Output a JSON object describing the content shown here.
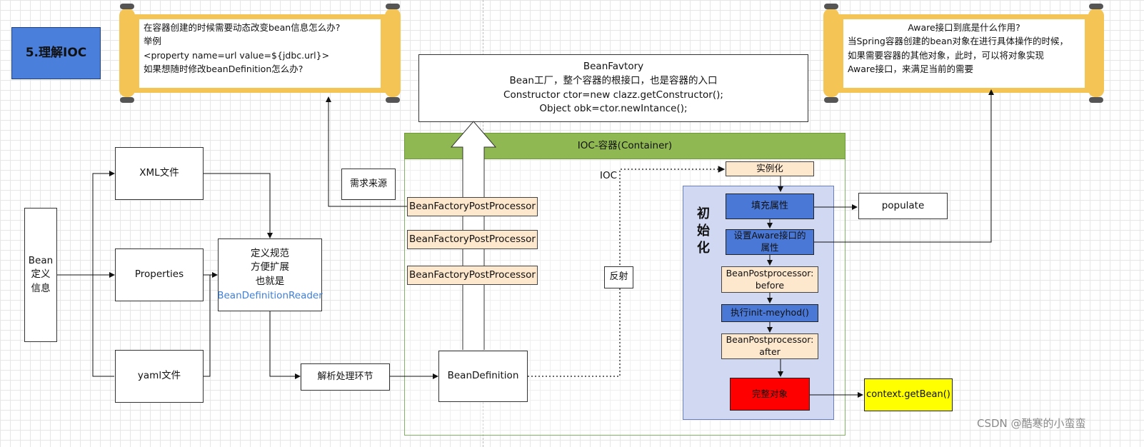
{
  "title": "5.理解IOC",
  "scroll_left": {
    "lines": [
      "在容器创建的时候需要动态改变bean信息怎么办?",
      "举例",
      "<property name=url value=${jdbc.url}>",
      "如果想随时修改beanDefinition怎么办?"
    ]
  },
  "scroll_right": {
    "lines": [
      "Aware接口到底是什么作用?",
      "当Spring容器创建的bean对象在进行具体操作的时候，",
      "如果需要容器的其他对象，此时，可以将对象实现",
      "Aware接口，来满足当前的需要"
    ]
  },
  "bean_factory": {
    "lines": [
      "BeanFavtory",
      "Bean工厂，整个容器的根接口，也是容器的入口",
      "Constructor ctor=new clazz.getConstructor();",
      "Object obk=ctor.newIntance();"
    ]
  },
  "container_title": "IOC-容器(Container)",
  "bean_def_info": [
    "Bean",
    "定义",
    "信息"
  ],
  "xml_file": "XML文件",
  "properties": "Properties",
  "yaml_file": "yaml文件",
  "reader": {
    "lines": [
      "定义规范",
      "方便扩展",
      "也就是"
    ],
    "link": "BeanDefinitionReader",
    "link_color": "#3f7fd8"
  },
  "parse": "解析处理环节",
  "bean_definition": "BeanDefinition",
  "demand_source": "需求来源",
  "post_processors": [
    "BeanFactoryPostProcessor",
    "BeanFactoryPostProcessor",
    "BeanFactoryPostProcessor"
  ],
  "ioc_label": "IOC",
  "reflect": "反射",
  "instantiate": "实例化",
  "init_label": [
    "初",
    "始",
    "化"
  ],
  "fill_attr": "填充属性",
  "populate": "populate",
  "aware": [
    "设置Aware接口的",
    "属性"
  ],
  "bpp_before": [
    "BeanPostprocessor:",
    "before"
  ],
  "init_method": "执行init-meyhod()",
  "bpp_after": [
    "BeanPostprocessor:",
    "after"
  ],
  "complete": "完整对象",
  "get_bean": "context.getBean()",
  "watermark": "CSDN @酷寒的小蛮蛮",
  "colors": {
    "title_bg": "#4a7fdc",
    "container_header": "#8fb852",
    "container_border": "#82b366",
    "init_panel": "#d0d8f2",
    "blue_box": "#4a78d6",
    "peach_box": "#fde7cd",
    "complete_red": "#ff0000",
    "getbean_yellow": "#ffff00",
    "scroll_gold": "#f4c455"
  }
}
